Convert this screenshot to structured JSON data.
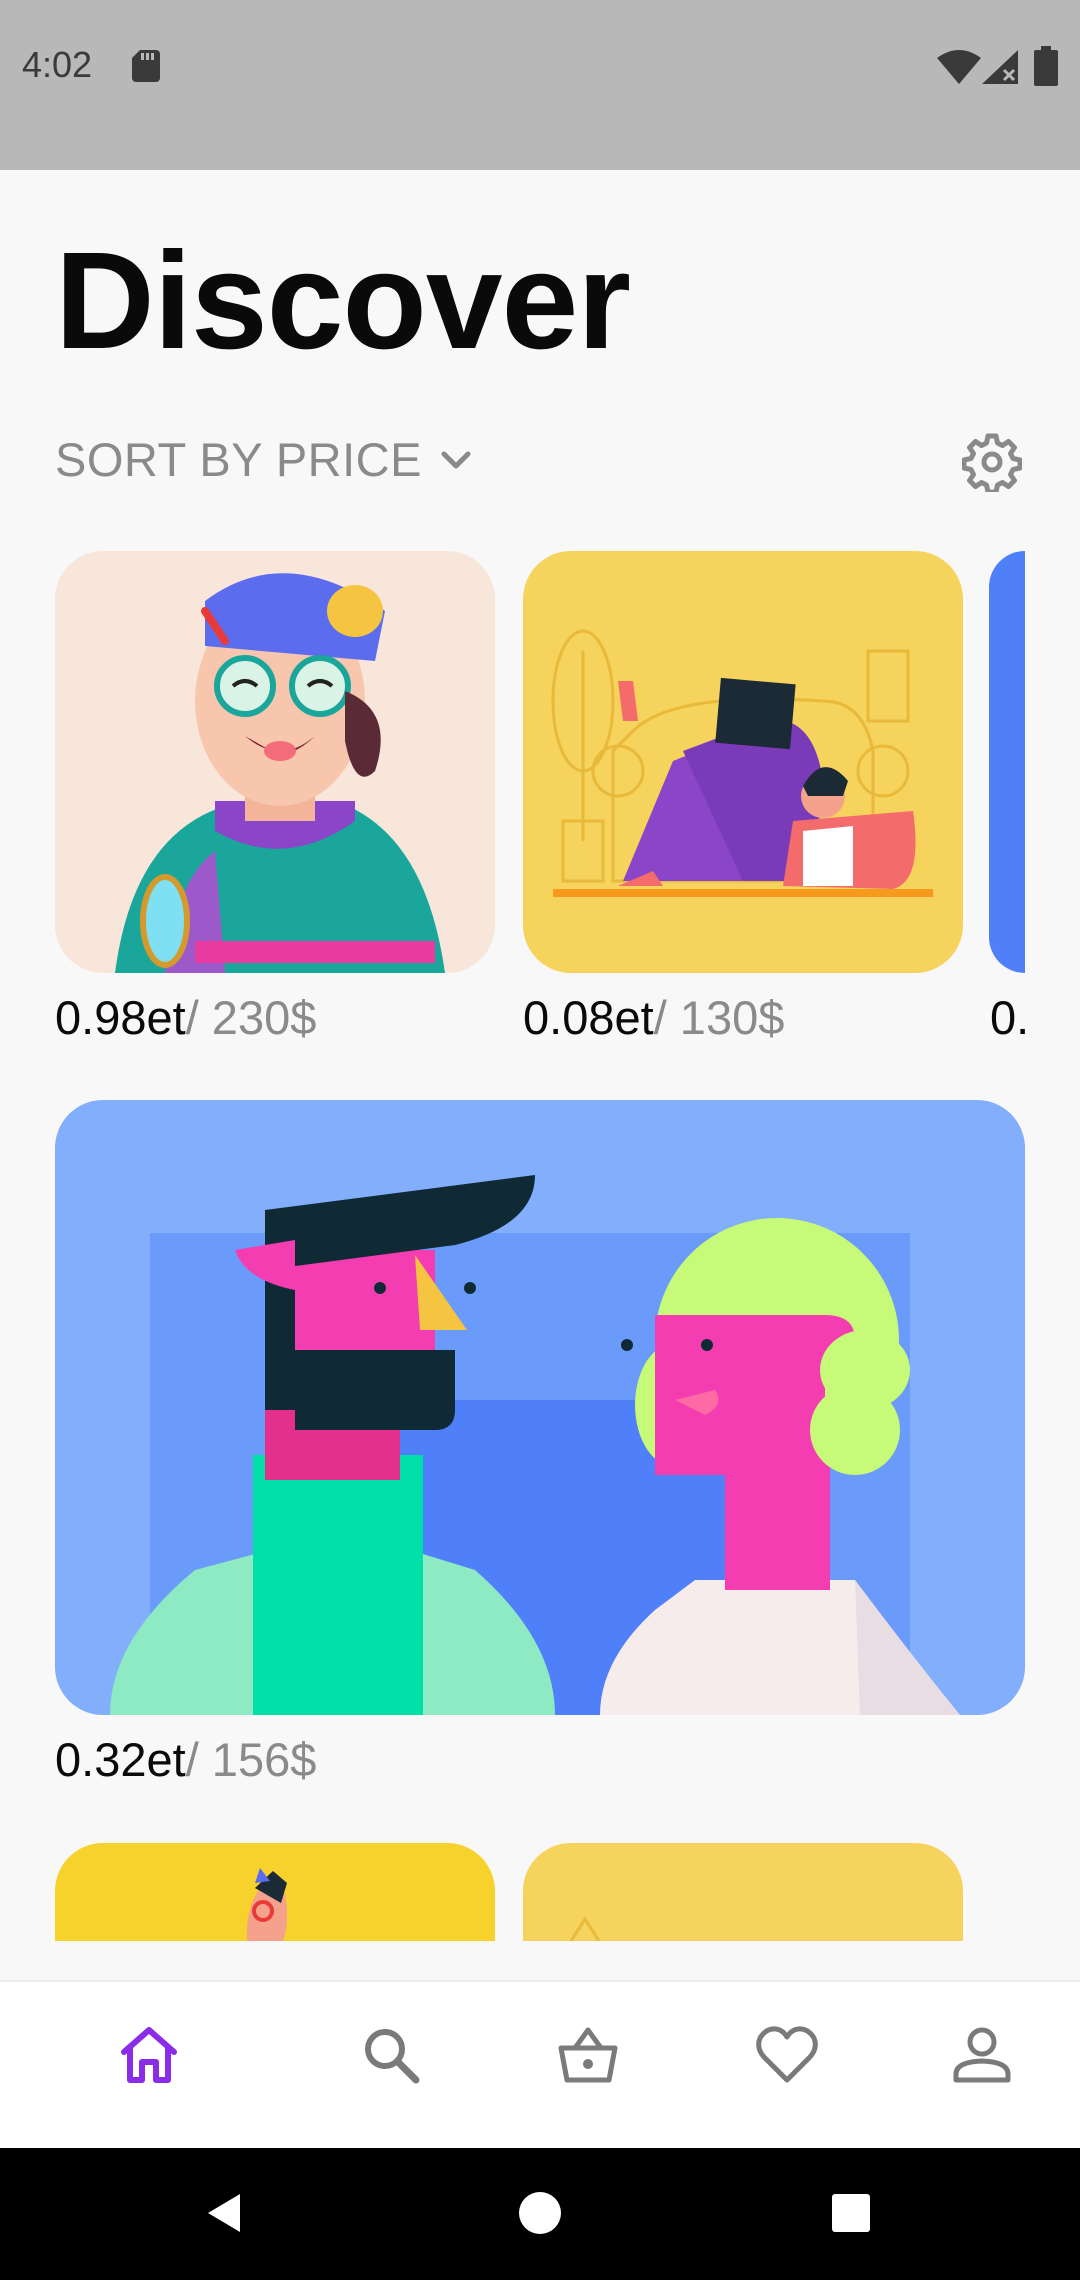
{
  "status_bar": {
    "time": "4:02"
  },
  "header": {
    "title": "Discover"
  },
  "sort": {
    "label": "SORT BY PRICE"
  },
  "cards": [
    {
      "price_et": "0.98et",
      "price_usd": "/ 230$",
      "bg": "#f8e6da"
    },
    {
      "price_et": "0.08et",
      "price_usd": "/ 130$",
      "bg": "#f5d35c"
    },
    {
      "price_et": "0.",
      "price_usd": "",
      "bg": "#4f7ff9"
    },
    {
      "price_et": "0.32et",
      "price_usd": "/ 156$",
      "bg": "#82aefc"
    },
    {
      "bg": "#f7d12c"
    },
    {
      "bg": "#f5d35c"
    }
  ],
  "bottom_nav": {
    "active_color": "#8b2ce8",
    "items": [
      {
        "icon": "home-icon",
        "label": "home"
      },
      {
        "icon": "search-icon"
      },
      {
        "icon": "basket-icon"
      },
      {
        "icon": "heart-icon"
      },
      {
        "icon": "user-icon"
      }
    ]
  }
}
